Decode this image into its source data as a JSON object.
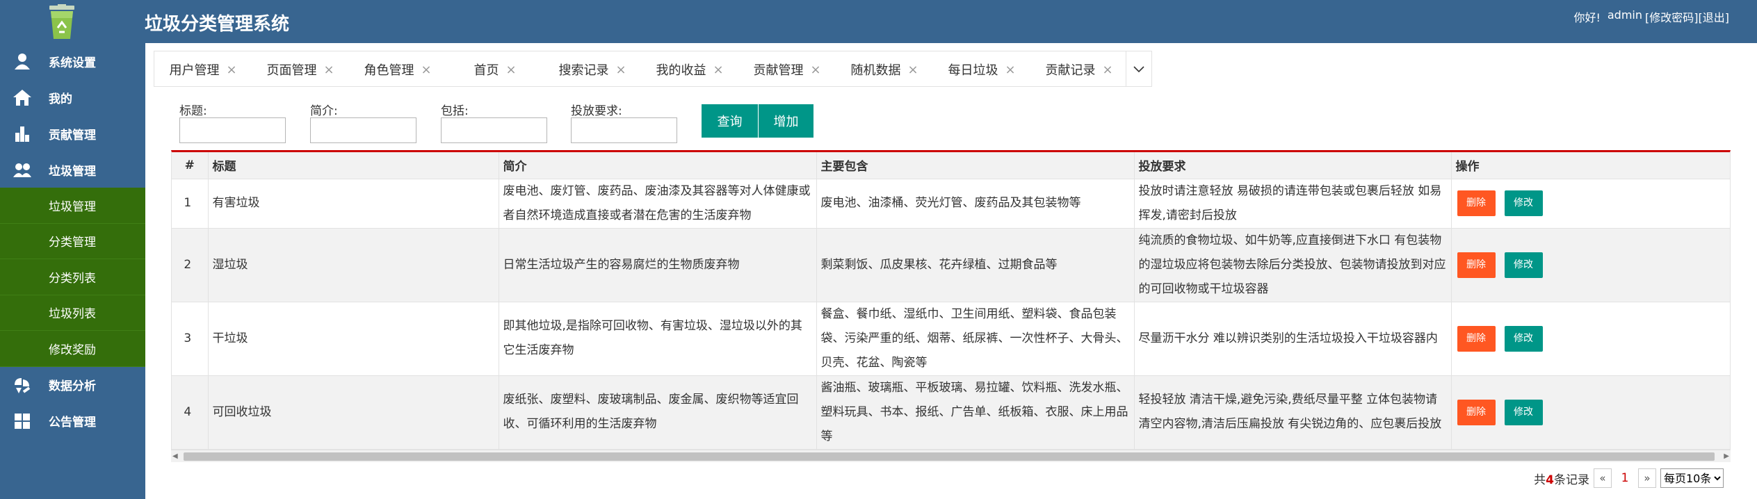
{
  "app": {
    "title": "垃圾分类管理系统",
    "greeting": "你好!",
    "username": "admin",
    "change_password": "[修改密码]",
    "logout": "[退出]"
  },
  "sidebar": {
    "items": [
      {
        "label": "系统设置",
        "icon": "user-icon"
      },
      {
        "label": "我的",
        "icon": "home-icon"
      },
      {
        "label": "贡献管理",
        "icon": "bar-chart-icon"
      },
      {
        "label": "垃圾管理",
        "icon": "group-icon"
      }
    ],
    "subitems": [
      "垃圾管理",
      "分类管理",
      "分类列表",
      "垃圾列表",
      "修改奖励"
    ],
    "bottom_items": [
      {
        "label": "数据分析",
        "icon": "chart-edit-icon"
      },
      {
        "label": "公告管理",
        "icon": "grid-icon"
      }
    ]
  },
  "tabs": [
    "用户管理",
    "页面管理",
    "角色管理",
    "首页",
    "搜索记录",
    "我的收益",
    "贡献管理",
    "随机数据",
    "每日垃圾",
    "贡献记录"
  ],
  "tab_close_glyph": "×",
  "search": {
    "fields": [
      {
        "label": "标题:",
        "value": ""
      },
      {
        "label": "简介:",
        "value": ""
      },
      {
        "label": "包括:",
        "value": ""
      },
      {
        "label": "投放要求:",
        "value": ""
      }
    ],
    "query_button": "查询",
    "add_button": "增加"
  },
  "table": {
    "headers": [
      "#",
      "标题",
      "简介",
      "主要包含",
      "投放要求",
      "操作"
    ],
    "rows": [
      {
        "num": "1",
        "title": "有害垃圾",
        "intro": "废电池、废灯管、废药品、废油漆及其容器等对人体健康或者自然环境造成直接或者潜在危害的生活废弃物",
        "contains": "废电池、油漆桶、荧光灯管、废药品及其包装物等",
        "requirement": "投放时请注意轻放 易破损的请连带包装或包裹后轻放 如易挥发,请密封后投放"
      },
      {
        "num": "2",
        "title": "湿垃圾",
        "intro": "日常生活垃圾产生的容易腐烂的生物质废弃物",
        "contains": "剩菜剩饭、瓜皮果核、花卉绿植、过期食品等",
        "requirement": "纯流质的食物垃圾、如牛奶等,应直接倒进下水口 有包装物的湿垃圾应将包装物去除后分类投放、包装物请投放到对应的可回收物或干垃圾容器"
      },
      {
        "num": "3",
        "title": "干垃圾",
        "intro": "即其他垃圾,是指除可回收物、有害垃圾、湿垃圾以外的其它生活废弃物",
        "contains": "餐盒、餐巾纸、湿纸巾、卫生间用纸、塑料袋、食品包装袋、污染严重的纸、烟蒂、纸尿裤、一次性杯子、大骨头、贝壳、花盆、陶瓷等",
        "requirement": "尽量沥干水分 难以辨识类别的生活垃圾投入干垃圾容器内"
      },
      {
        "num": "4",
        "title": "可回收垃圾",
        "intro": "废纸张、废塑料、废玻璃制品、废金属、废织物等适宜回收、可循环利用的生活废弃物",
        "contains": "酱油瓶、玻璃瓶、平板玻璃、易拉罐、饮料瓶、洗发水瓶、塑料玩具、书本、报纸、广告单、纸板箱、衣服、床上用品等",
        "requirement": "轻投轻放 清洁干燥,避免污染,费纸尽量平整 立体包装物请清空内容物,清洁后压扁投放 有尖锐边角的、应包裹后投放"
      }
    ],
    "delete_label": "删除",
    "edit_label": "修改"
  },
  "pagination": {
    "total_prefix": "共",
    "total_count": "4",
    "total_suffix": "条记录",
    "prev": "«",
    "current_page": "1",
    "next": "»",
    "page_size": "每页10条"
  }
}
